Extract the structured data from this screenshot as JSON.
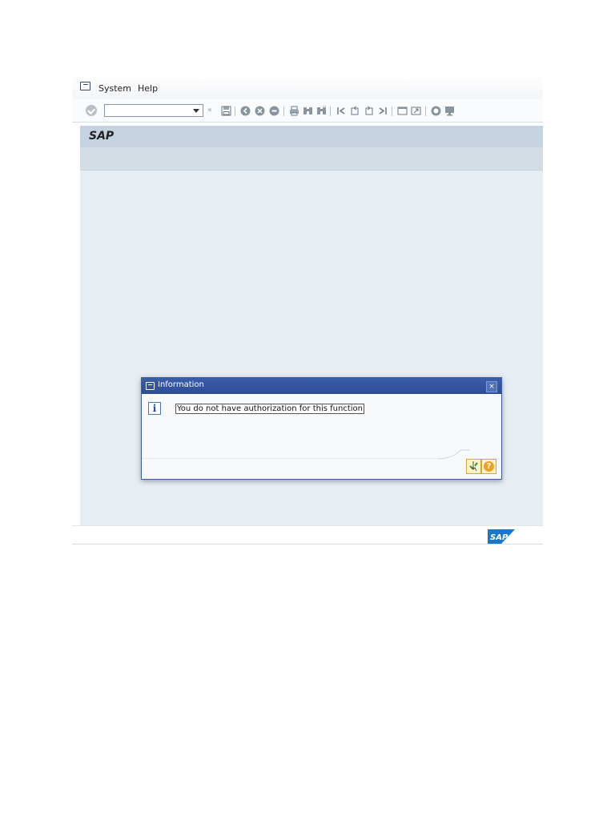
{
  "menubar": {
    "items": [
      {
        "label": "System"
      },
      {
        "label": "Help"
      }
    ]
  },
  "toolbar": {
    "command_field_value": "",
    "icons": [
      "save-icon",
      "back-icon",
      "exit-icon",
      "cancel-icon",
      "print-icon",
      "find-icon",
      "find-next-icon",
      "first-page-icon",
      "previous-page-icon",
      "next-page-icon",
      "last-page-icon",
      "create-session-icon",
      "shortcut-icon",
      "help-icon",
      "customize-layout-icon"
    ]
  },
  "title": "SAP",
  "dialog": {
    "title": "Information",
    "message": "You do not have authorization for this function",
    "close_glyph": "×",
    "help_glyph": "?"
  },
  "footer": {
    "logo_text": "SAP"
  },
  "colors": {
    "dialog_header": "#2c4d96",
    "canvas": "#e6edf3",
    "title_bar": "#c5d2df",
    "sap_logo": "#1a77c9"
  }
}
